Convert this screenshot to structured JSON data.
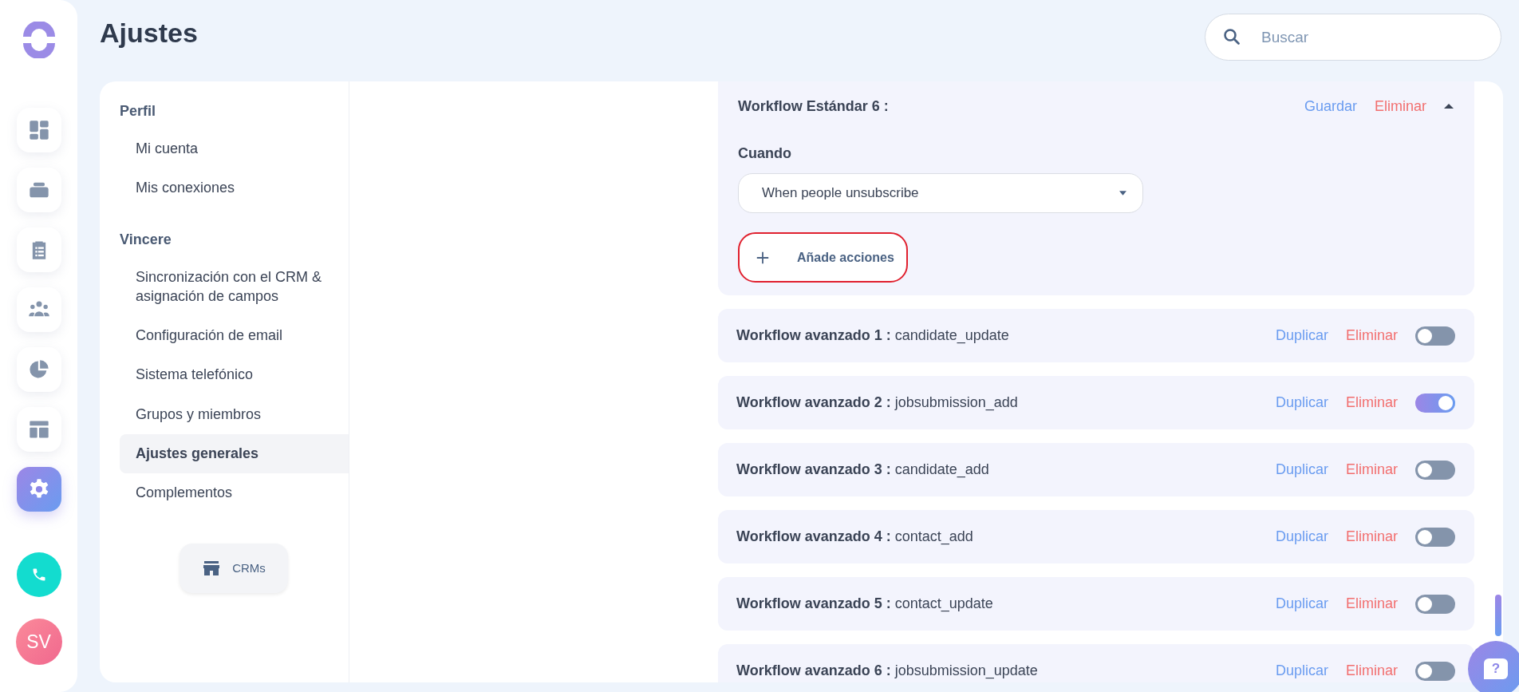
{
  "rail": {
    "nav": [
      {
        "kind": "dashboard",
        "selected": false
      },
      {
        "kind": "inbox",
        "selected": false
      },
      {
        "kind": "clipboard",
        "selected": false
      },
      {
        "kind": "people",
        "selected": false
      },
      {
        "kind": "pie",
        "selected": false
      },
      {
        "kind": "layout",
        "selected": false
      },
      {
        "kind": "settings",
        "selected": true
      }
    ],
    "avatar": "SV"
  },
  "title": "Ajustes",
  "help_button": "?",
  "search": {
    "placeholder": "Buscar"
  },
  "settings_menu": {
    "sections": [
      {
        "heading": "Perfil",
        "items": [
          {
            "label": "Mi cuenta",
            "selected": false
          },
          {
            "label": "Mis conexiones",
            "selected": false
          }
        ]
      },
      {
        "heading": "Vincere",
        "items": [
          {
            "label": "Sincronización con el CRM & asignación de campos",
            "selected": false
          },
          {
            "label": "Configuración de email",
            "selected": false
          },
          {
            "label": "Sistema telefónico",
            "selected": false
          },
          {
            "label": "Grupos y miembros",
            "selected": false
          },
          {
            "label": "Ajustes generales",
            "selected": true
          },
          {
            "label": "Complementos",
            "selected": false
          }
        ]
      }
    ],
    "crm_button": "CRMs"
  },
  "standard_workflow": {
    "title": "Workflow Estándar 6 :",
    "save": "Guardar",
    "delete": "Eliminar",
    "expanded": true,
    "when_label": "Cuando",
    "trigger": "When people unsubscribe",
    "add_actions": "Añade acciones"
  },
  "advanced_workflows": [
    {
      "name": "Workflow avanzado 1 :",
      "event": "candidate_update",
      "duplicate": "Duplicar",
      "delete": "Eliminar",
      "on": false
    },
    {
      "name": "Workflow avanzado 2 :",
      "event": "jobsubmission_add",
      "duplicate": "Duplicar",
      "delete": "Eliminar",
      "on": true
    },
    {
      "name": "Workflow avanzado 3 :",
      "event": "candidate_add",
      "duplicate": "Duplicar",
      "delete": "Eliminar",
      "on": false
    },
    {
      "name": "Workflow avanzado 4 :",
      "event": "contact_add",
      "duplicate": "Duplicar",
      "delete": "Eliminar",
      "on": false
    },
    {
      "name": "Workflow avanzado 5 :",
      "event": "contact_update",
      "duplicate": "Duplicar",
      "delete": "Eliminar",
      "on": false
    },
    {
      "name": "Workflow avanzado 6 :",
      "event": "jobsubmission_update",
      "duplicate": "Duplicar",
      "delete": "Eliminar",
      "on": false
    }
  ]
}
